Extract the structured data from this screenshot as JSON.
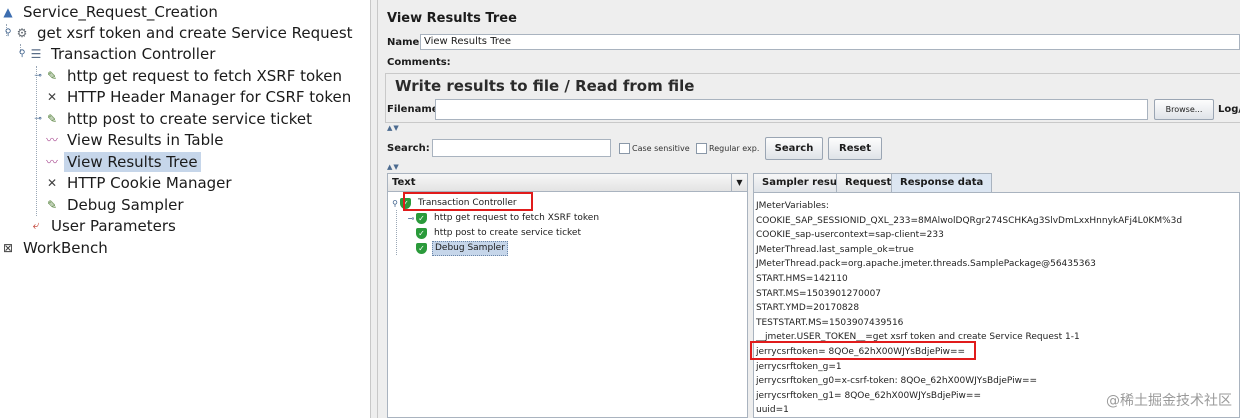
{
  "test_plan": {
    "items": [
      {
        "label": "Service_Request_Creation",
        "icon": "test-plan-icon"
      },
      {
        "label": "get xsrf token and create Service Request",
        "icon": "thread-group-icon"
      },
      {
        "label": "Transaction Controller",
        "icon": "controller-icon"
      },
      {
        "label": "http get request to fetch XSRF token",
        "icon": "sampler-icon"
      },
      {
        "label": "HTTP Header Manager for CSRF token",
        "icon": "config-icon"
      },
      {
        "label": "http post to create service ticket",
        "icon": "sampler-icon"
      },
      {
        "label": "View Results in Table",
        "icon": "listener-icon"
      },
      {
        "label": "View Results Tree",
        "icon": "listener-icon"
      },
      {
        "label": "HTTP Cookie Manager",
        "icon": "config-icon"
      },
      {
        "label": "Debug Sampler",
        "icon": "sampler-icon"
      },
      {
        "label": "User Parameters",
        "icon": "pre-processor-icon"
      },
      {
        "label": "WorkBench",
        "icon": "workbench-icon"
      }
    ],
    "selected": "View Results Tree"
  },
  "panel": {
    "title": "View Results Tree",
    "name_label": "Name:",
    "name_value": "View Results Tree",
    "comments_label": "Comments:",
    "file_group_title": "Write results to file / Read from file",
    "filename_label": "Filename",
    "browse_button": "Browse...",
    "log_label": "Log/I",
    "search_label": "Search:",
    "case_sensitive_label": "Case sensitive",
    "regex_label": "Regular exp.",
    "search_button": "Search",
    "reset_button": "Reset"
  },
  "results_tree": {
    "header": "Text",
    "items": [
      {
        "label": "Transaction Controller"
      },
      {
        "label": "http get request to fetch XSRF token"
      },
      {
        "label": "http post to create service ticket"
      },
      {
        "label": "Debug Sampler"
      }
    ]
  },
  "tabs": {
    "sampler_result": "Sampler result",
    "request": "Request",
    "response_data": "Response data"
  },
  "response_lines": [
    "JMeterVariables:",
    "COOKIE_SAP_SESSIONID_QXL_233=8MAlwolDQRgr274SCHKAg3SlvDmLxxHnnykAFj4L0KM%3d",
    "COOKIE_sap-usercontext=sap-client=233",
    "JMeterThread.last_sample_ok=true",
    "JMeterThread.pack=org.apache.jmeter.threads.SamplePackage@56435363",
    "START.HMS=142110",
    "START.MS=1503901270007",
    "START.YMD=20170828",
    "TESTSTART.MS=1503907439516",
    "__jmeter.USER_TOKEN__=get xsrf token and create Service Request 1-1",
    "jerrycsrftoken= 8QOe_62hX00WJYsBdjePiw==",
    "jerrycsrftoken_g=1",
    "jerrycsrftoken_g0=x-csrf-token: 8QOe_62hX00WJYsBdjePiw==",
    "jerrycsrftoken_g1= 8QOe_62hX00WJYsBdjePiw==",
    "uuid=1"
  ],
  "watermark": "@稀土掘金技术社区"
}
